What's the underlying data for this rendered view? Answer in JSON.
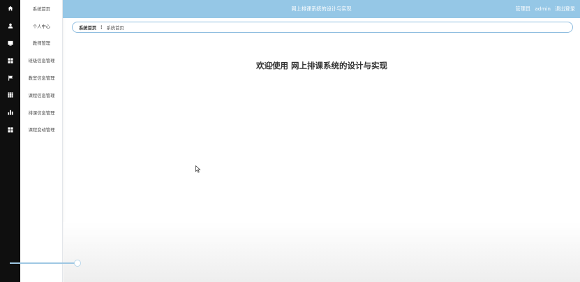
{
  "header": {
    "title": "网上排课系统的设计与实现",
    "user_role": "管理员",
    "username": "admin",
    "logout": "退出登录"
  },
  "sidebar": {
    "items": [
      {
        "label": "系统首页",
        "icon": "home-icon"
      },
      {
        "label": "个人中心",
        "icon": "user-icon"
      },
      {
        "label": "教师管理",
        "icon": "monitor-icon"
      },
      {
        "label": "班级信息管理",
        "icon": "grid-icon"
      },
      {
        "label": "教室信息管理",
        "icon": "flag-icon"
      },
      {
        "label": "课程信息管理",
        "icon": "table-icon"
      },
      {
        "label": "排课信息管理",
        "icon": "bar-chart-icon"
      },
      {
        "label": "课程变动管理",
        "icon": "grid-icon"
      }
    ]
  },
  "breadcrumb": {
    "home": "系统首页",
    "separator": "⋮",
    "current": "系统首页"
  },
  "main": {
    "welcome": "欢迎使用 网上排课系统的设计与实现"
  },
  "colors": {
    "header_bg": "#95c7e6",
    "rail_bg": "#0f0f0f",
    "breadcrumb_border": "#8fbde0"
  }
}
